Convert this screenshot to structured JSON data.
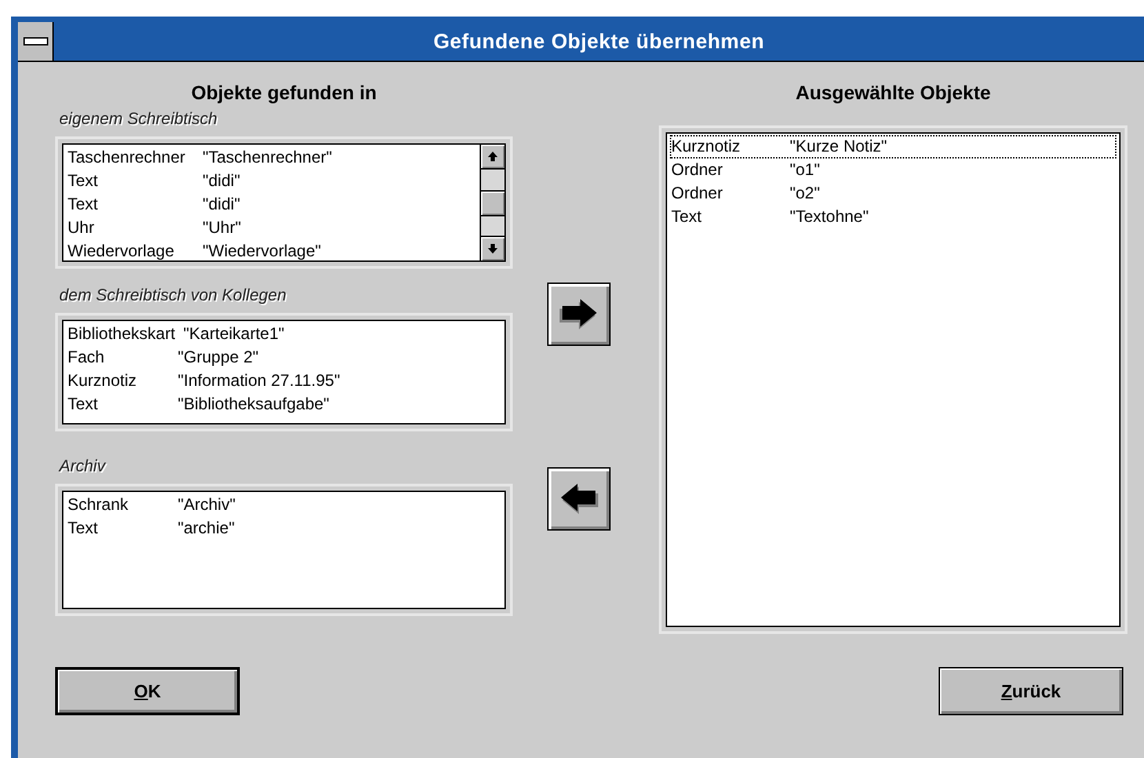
{
  "window": {
    "title": "Gefundene Objekte übernehmen"
  },
  "found_heading": "Objekte gefunden in",
  "sources": [
    {
      "label": "eigenem Schreibtisch",
      "scrollbar": true,
      "items": [
        {
          "type": "Taschenrechner",
          "name": "\"Taschenrechner\""
        },
        {
          "type": "Text",
          "name": "\"didi\""
        },
        {
          "type": "Text",
          "name": "\"didi\""
        },
        {
          "type": "Uhr",
          "name": "\"Uhr\""
        },
        {
          "type": "Wiedervorlage",
          "name": "\"Wiedervorlage\""
        }
      ]
    },
    {
      "label": "dem Schreibtisch von Kollegen",
      "scrollbar": false,
      "items": [
        {
          "type": "Bibliothekskart",
          "name": "\"Karteikarte1\""
        },
        {
          "type": "Fach",
          "name": "\"Gruppe 2\""
        },
        {
          "type": "Kurznotiz",
          "name": "\"Information 27.11.95\""
        },
        {
          "type": "Text",
          "name": "\"Bibliotheksaufgabe\""
        }
      ]
    },
    {
      "label": "Archiv",
      "scrollbar": false,
      "items": [
        {
          "type": "Schrank",
          "name": "\"Archiv\""
        },
        {
          "type": "Text",
          "name": "\"archie\""
        }
      ]
    }
  ],
  "selected_heading": "Ausgewählte Objekte",
  "selected_items": [
    {
      "type": "Kurznotiz",
      "name": "\"Kurze Notiz\"",
      "focused": true
    },
    {
      "type": "Ordner",
      "name": "\"o1\"",
      "focused": false
    },
    {
      "type": "Ordner",
      "name": "\"o2\"",
      "focused": false
    },
    {
      "type": "Text",
      "name": "\"Textohne\"",
      "focused": false
    }
  ],
  "buttons": [
    {
      "key": "O",
      "rest": "K",
      "default": true
    },
    {
      "key": "Z",
      "rest": "urück",
      "default": false
    }
  ]
}
